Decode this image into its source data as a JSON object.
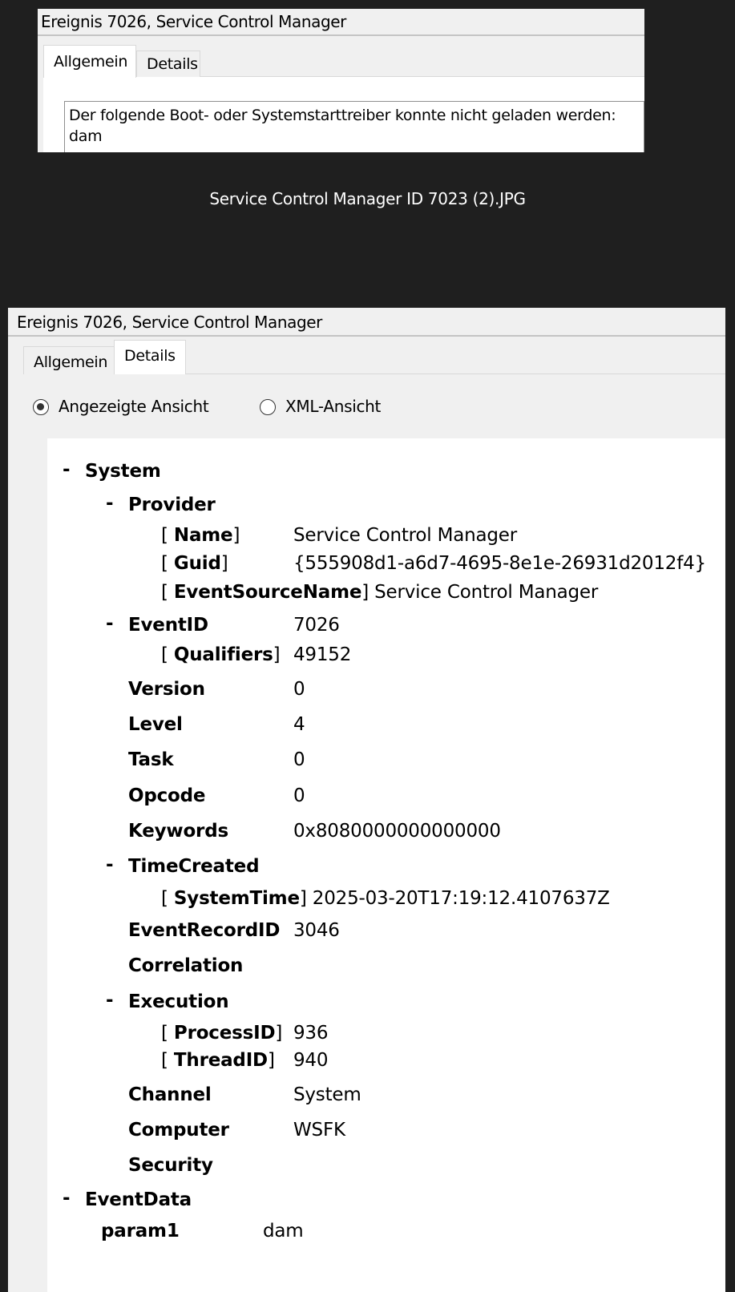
{
  "top_window": {
    "title": "Ereignis 7026, Service Control Manager",
    "tabs": [
      "Allgemein",
      "Details"
    ],
    "message_line1": "Der folgende Boot- oder Systemstarttreiber konnte nicht geladen werden:",
    "message_line2": "dam"
  },
  "caption": "Service Control Manager ID 7023 (2).JPG",
  "bottom_window": {
    "title": "Ereignis 7026, Service Control Manager",
    "tabs": [
      "Allgemein",
      "Details"
    ],
    "view_options": {
      "friendly": "Angezeigte Ansicht",
      "xml": "XML-Ansicht",
      "selected": "friendly"
    },
    "tree": {
      "collapse_symbol": "-",
      "open_bracket": "[",
      "close_bracket": "]",
      "system": "System",
      "provider": "Provider",
      "provider_name_key": "Name",
      "provider_name_val": "Service Control Manager",
      "provider_guid_key": "Guid",
      "provider_guid_val": "{555908d1-a6d7-4695-8e1e-26931d2012f4}",
      "provider_esn_key": "EventSourceName",
      "provider_esn_val": "Service Control Manager",
      "eventid_key": "EventID",
      "eventid_val": "7026",
      "qualifiers_key": "Qualifiers",
      "qualifiers_val": "49152",
      "version_key": "Version",
      "version_val": "0",
      "level_key": "Level",
      "level_val": "4",
      "task_key": "Task",
      "task_val": "0",
      "opcode_key": "Opcode",
      "opcode_val": "0",
      "keywords_key": "Keywords",
      "keywords_val": "0x8080000000000000",
      "timecreated_key": "TimeCreated",
      "systemtime_key": "SystemTime",
      "systemtime_val": "2025-03-20T17:19:12.4107637Z",
      "eventrecordid_key": "EventRecordID",
      "eventrecordid_val": "3046",
      "correlation_key": "Correlation",
      "execution_key": "Execution",
      "processid_key": "ProcessID",
      "processid_val": "936",
      "threadid_key": "ThreadID",
      "threadid_val": "940",
      "channel_key": "Channel",
      "channel_val": "System",
      "computer_key": "Computer",
      "computer_val": "WSFK",
      "security_key": "Security",
      "eventdata": "EventData",
      "param1_key": "param1",
      "param1_val": "dam"
    }
  }
}
